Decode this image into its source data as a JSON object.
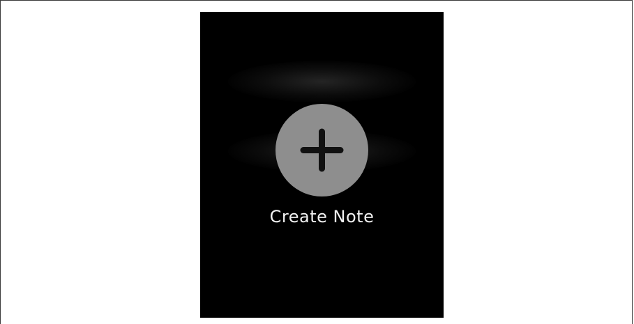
{
  "screen": {
    "background_color": "#000000",
    "button_color": "#8e8e8e",
    "icon": "plus-icon",
    "label": "Create Note"
  }
}
